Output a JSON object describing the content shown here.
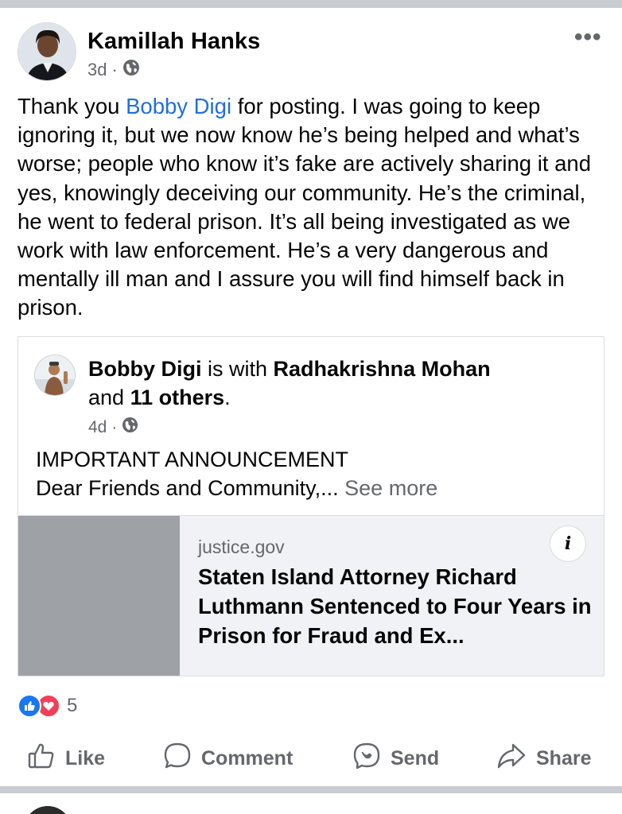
{
  "post": {
    "author": "Kamillah Hanks",
    "time": "3d",
    "separator": "·",
    "privacy_icon": "globe-icon",
    "more_label": "•••",
    "text_before_mention": "Thank you ",
    "mention": "Bobby Digi",
    "text_after_mention": " for posting. I was going to keep ignoring it, but we now know he’s being helped and what’s worse; people who know it’s fake are actively sharing it and yes, knowingly deceiving our community. He’s the criminal, he went to federal prison. It’s all being investigated as we work with law enforcement. He’s a very dangerous and mentally ill man and I assure you will find himself back in prison."
  },
  "shared_post": {
    "author": "Bobby Digi",
    "with_text": " is with ",
    "tagged": "Radhakrishna Mohan",
    "and_text": "and ",
    "others": "11 others",
    "period": ".",
    "time": "4d",
    "separator": "·",
    "privacy_icon": "globe-icon",
    "body_line1": "IMPORTANT ANNOUNCEMENT",
    "body_line2": "Dear Friends and Community,...",
    "see_more": "See more",
    "link": {
      "domain": "justice.gov",
      "title": "Staten Island Attorney Richard Luthmann Sentenced to Four Years in Prison for Fraud and Ex...",
      "info_label": "i"
    }
  },
  "reactions": {
    "count": "5",
    "icons": [
      "like-reaction-icon",
      "love-reaction-icon"
    ]
  },
  "actions": {
    "like": "Like",
    "comment": "Comment",
    "send": "Send",
    "share": "Share"
  },
  "colors": {
    "link": "#216fdb",
    "secondary_text": "#65676b",
    "like_blue": "#1877f2",
    "love_red": "#f33e58",
    "separator": "#c9ccd1"
  }
}
